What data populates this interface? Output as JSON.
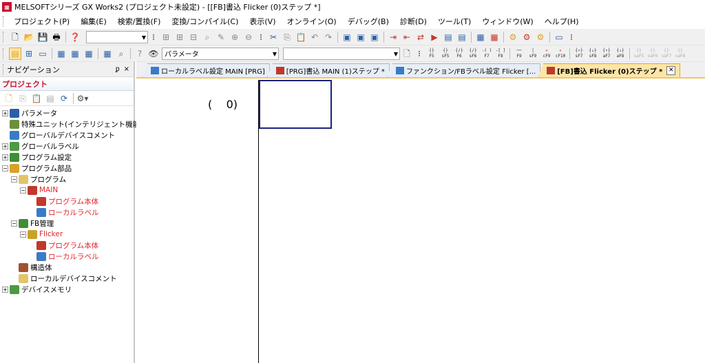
{
  "window": {
    "title": "MELSOFTシリーズ GX Works2 (プロジェクト未設定) - [[FB]書込 Flicker (0)ステップ *]"
  },
  "menu": [
    "プロジェクト(P)",
    "編集(E)",
    "検索/置換(F)",
    "変換/コンパイル(C)",
    "表示(V)",
    "オンライン(O)",
    "デバッグ(B)",
    "診断(D)",
    "ツール(T)",
    "ウィンドウ(W)",
    "ヘルプ(H)"
  ],
  "toolbar": {
    "param_combo_value": "パラメータ",
    "fkeys": [
      [
        "F5",
        "sF5",
        "F6",
        "sF6",
        "F7",
        "F8"
      ],
      [
        "F9",
        "sF9",
        "cF9",
        "cF10"
      ],
      [
        "sF7",
        "sF8",
        "aF7",
        "aF8"
      ],
      [
        "saF5",
        "saF6",
        "saF7",
        "saF8"
      ]
    ]
  },
  "navigation": {
    "title": "ナビゲーション",
    "pin": "ᵱ",
    "close": "×",
    "section": "プロジェクト",
    "tree": [
      {
        "label": "パラメータ",
        "level": 0,
        "expander": "+",
        "icon": "#2c5ea8",
        "red": false
      },
      {
        "label": "特殊ユニット(インテリジェント機能ユニ",
        "level": 0,
        "expander": "",
        "icon": "#6c8f3a",
        "red": false
      },
      {
        "label": "グローバルデバイスコメント",
        "level": 0,
        "expander": "",
        "icon": "#3a7bc8",
        "red": false
      },
      {
        "label": "グローバルラベル",
        "level": 0,
        "expander": "+",
        "icon": "#4b9b43",
        "red": false
      },
      {
        "label": "プログラム設定",
        "level": 0,
        "expander": "+",
        "icon": "#3f8e3a",
        "red": false
      },
      {
        "label": "プログラム部品",
        "level": 0,
        "expander": "−",
        "icon": "#d9a12a",
        "red": false
      },
      {
        "label": "プログラム",
        "level": 1,
        "expander": "−",
        "icon": "#e1c56a",
        "red": false
      },
      {
        "label": "MAIN",
        "level": 2,
        "expander": "−",
        "icon": "#c0392b",
        "red": true
      },
      {
        "label": "プログラム本体",
        "level": 3,
        "expander": "",
        "icon": "#c0392b",
        "red": true
      },
      {
        "label": "ローカルラベル",
        "level": 3,
        "expander": "",
        "icon": "#3a7bc8",
        "red": true
      },
      {
        "label": "FB管理",
        "level": 1,
        "expander": "−",
        "icon": "#3f8e3a",
        "red": false
      },
      {
        "label": "Flicker",
        "level": 2,
        "expander": "−",
        "icon": "#c9a227",
        "red": true
      },
      {
        "label": "プログラム本体",
        "level": 3,
        "expander": "",
        "icon": "#c0392b",
        "red": true
      },
      {
        "label": "ローカルラベル",
        "level": 3,
        "expander": "",
        "icon": "#3a7bc8",
        "red": true
      },
      {
        "label": "構造体",
        "level": 1,
        "expander": "",
        "icon": "#a0522d",
        "red": false
      },
      {
        "label": "ローカルデバイスコメント",
        "level": 1,
        "expander": "",
        "icon": "#e1c56a",
        "red": false
      },
      {
        "label": "デバイスメモリ",
        "level": 0,
        "expander": "+",
        "icon": "#4b9b43",
        "red": false
      }
    ]
  },
  "tabs": [
    {
      "label": "ローカルラベル設定 MAIN [PRG]",
      "active": false
    },
    {
      "label": "[PRG]書込 MAIN (1)ステップ *",
      "active": false
    },
    {
      "label": "ファンクション/FBラベル設定 Flicker [...",
      "active": false
    },
    {
      "label": "[FB]書込 Flicker (0)ステップ *",
      "active": true
    }
  ],
  "tab_close": "✕",
  "editor": {
    "step_open": "(",
    "step_number": "0)"
  }
}
